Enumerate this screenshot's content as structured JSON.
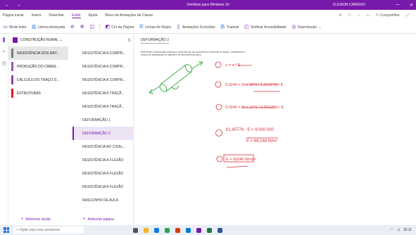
{
  "titlebar": {
    "back": "←",
    "forward": "→",
    "title": "OneNote para Windows 10",
    "user": "CLEISON CANDIDO",
    "minimize": "—",
    "close": "✕"
  },
  "menu": {
    "items": [
      "Página inicial",
      "Inserir",
      "Desenhar",
      "Exibir",
      "Ajuda",
      "Bloco de Anotações de Classe"
    ],
    "active_index": 3,
    "share": "Compartilhar"
  },
  "toolbar": {
    "items": [
      "Modo leitor",
      "Leitura Avançada",
      "Zoom Menos",
      "Zoom Mais",
      "100%",
      "Cor da Página",
      "Linhas de Regra",
      "Anotações Excluídas",
      "Traduzir",
      "Verificar Acessibilidade",
      "Reprodução"
    ]
  },
  "notebook": {
    "name": "CONSTRUÇÃO RURAL"
  },
  "sections": [
    {
      "label": "RESISTÊNCIA DOS MAT...",
      "color": "#7a7a7a",
      "selected": true
    },
    {
      "label": "PRODUÇÃO DO CIMEN...",
      "color": "#9b59b6",
      "selected": false
    },
    {
      "label": "CÁLCULO DO TRAÇO D...",
      "color": "#8e44ad",
      "selected": false
    },
    {
      "label": "ESTRUTURAS",
      "color": "#e81123",
      "selected": false
    }
  ],
  "pages": [
    {
      "label": "RESISTÊNCIA A COMPR...",
      "selected": false
    },
    {
      "label": "RESISTÊNCIA A COMPR...",
      "selected": false
    },
    {
      "label": "RESISTÊNCIA A COMPR...",
      "selected": false
    },
    {
      "label": "RESISTÊNCIA A TRAÇÃ...",
      "selected": false
    },
    {
      "label": "RESISTÊNCIA A TRAÇÃ...",
      "selected": false
    },
    {
      "label": "DEFORMAÇÃO 1",
      "selected": false
    },
    {
      "label": "DEFORMAÇÃO 2",
      "selected": true
    },
    {
      "label": "RESISTÊNCIA AO CISAL...",
      "selected": false
    },
    {
      "label": "RESISTÊNCIA A FLEXÃO",
      "selected": false
    },
    {
      "label": "RESISTÊNCIA A FLEXÃO",
      "selected": false
    },
    {
      "label": "RESISTÊNCIA A FLEXÃO",
      "selected": false
    },
    {
      "label": "RASCUNHO DE AULA",
      "selected": false
    }
  ],
  "add_section": "Adicionar seção",
  "add_page": "Adicionar página",
  "canvas": {
    "page_title": "DEFORMAÇÃO 2",
    "description": "Determinar a deformação sofrida por uma barra de aço submetida a uma força de tração, considerando o módulo de elasticidade do material e as dimensões da barra.",
    "equations": [
      "ε = σ / E",
      "0,0244 = (9 x 10^6 / 1,2x10^3) / E",
      "0,0244 = (9 x 10^6 / 0,001256) / E",
      "81,45776 · E = 9.000.000",
      "E = 69.246 N/m²",
      "E = 69246 N/mm²"
    ]
  },
  "taskbar": {
    "search_placeholder": "Digite aqui para pesquisar",
    "time": "16:11"
  },
  "colors": {
    "accent": "#7719aa",
    "ink_red": "#e0303a",
    "ink_green": "#3cb043"
  }
}
